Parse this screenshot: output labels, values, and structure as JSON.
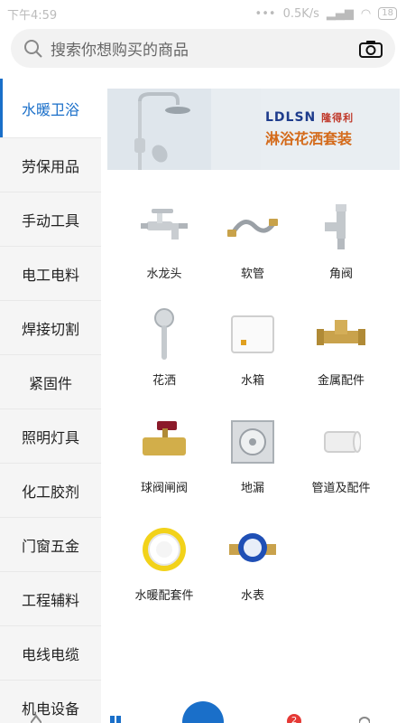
{
  "status_bar": {
    "time": "下午4:59",
    "network_speed": "0.5K/s",
    "battery": "18"
  },
  "search": {
    "placeholder": "搜索你想购买的商品"
  },
  "sidebar": {
    "items": [
      {
        "label": "水暖卫浴",
        "active": true
      },
      {
        "label": "劳保用品"
      },
      {
        "label": "手动工具"
      },
      {
        "label": "电工电料"
      },
      {
        "label": "焊接切割"
      },
      {
        "label": "紧固件"
      },
      {
        "label": "照明灯具"
      },
      {
        "label": "化工胶剂"
      },
      {
        "label": "门窗五金"
      },
      {
        "label": "工程辅料"
      },
      {
        "label": "电线电缆"
      },
      {
        "label": "机电设备"
      }
    ]
  },
  "banner": {
    "brand": "LDLSN",
    "brand_cn": "隆得利",
    "caption": "淋浴花洒套装"
  },
  "categories": [
    {
      "label": "水龙头",
      "icon": "faucet-icon"
    },
    {
      "label": "软管",
      "icon": "hose-icon"
    },
    {
      "label": "角阀",
      "icon": "angle-valve-icon"
    },
    {
      "label": "花洒",
      "icon": "shower-head-icon"
    },
    {
      "label": "水箱",
      "icon": "water-tank-icon"
    },
    {
      "label": "金属配件",
      "icon": "brass-fitting-icon"
    },
    {
      "label": "球阀闸阀",
      "icon": "ball-valve-icon"
    },
    {
      "label": "地漏",
      "icon": "floor-drain-icon"
    },
    {
      "label": "管道及配件",
      "icon": "pipe-fitting-icon"
    },
    {
      "label": "水暖配套件",
      "icon": "ptfe-tape-icon"
    },
    {
      "label": "水表",
      "icon": "water-meter-icon"
    }
  ],
  "bottom_nav": {
    "cart_badge": "2"
  },
  "colors": {
    "accent": "#1a6fc9",
    "sidebar_bg": "#f5f5f5",
    "badge": "#e53935"
  }
}
